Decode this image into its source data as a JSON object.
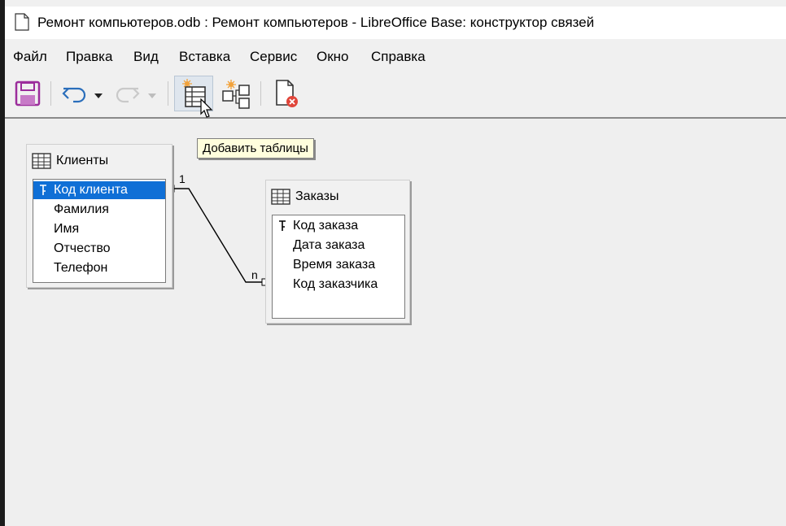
{
  "window": {
    "title": "Ремонт компьютеров.odb : Ремонт компьютеров - LibreOffice Base: конструктор связей"
  },
  "menu": {
    "items": [
      "Файл",
      "Правка",
      "Вид",
      "Вставка",
      "Сервис",
      "Окно",
      "Справка"
    ]
  },
  "toolbar": {
    "buttons": [
      {
        "name": "save",
        "icon": "save-icon"
      },
      {
        "name": "undo",
        "icon": "undo-icon"
      },
      {
        "name": "redo",
        "icon": "redo-icon"
      },
      {
        "name": "add-tables",
        "icon": "add-table-icon",
        "active": true
      },
      {
        "name": "new-relation",
        "icon": "new-relation-icon"
      },
      {
        "name": "close",
        "icon": "close-document-icon"
      }
    ]
  },
  "tooltip": {
    "text": "Добавить таблицы"
  },
  "tables": [
    {
      "title": "Клиенты",
      "fields": [
        {
          "name": "Код клиента",
          "key": true,
          "selected": true
        },
        {
          "name": "Фамилия"
        },
        {
          "name": "Имя"
        },
        {
          "name": "Отчество"
        },
        {
          "name": "Телефон"
        }
      ]
    },
    {
      "title": "Заказы",
      "fields": [
        {
          "name": "Код заказа",
          "key": true
        },
        {
          "name": "Дата заказа"
        },
        {
          "name": "Время заказа"
        },
        {
          "name": "Код заказчика"
        }
      ]
    }
  ],
  "relation": {
    "from_card": "1",
    "to_card": "n"
  },
  "colors": {
    "selection": "#0f6fd6",
    "tooltip_bg": "#fffedd",
    "save_icon": "#9b2d9b",
    "undo_icon": "#2a6ebb",
    "close_badge": "#e0453a"
  }
}
